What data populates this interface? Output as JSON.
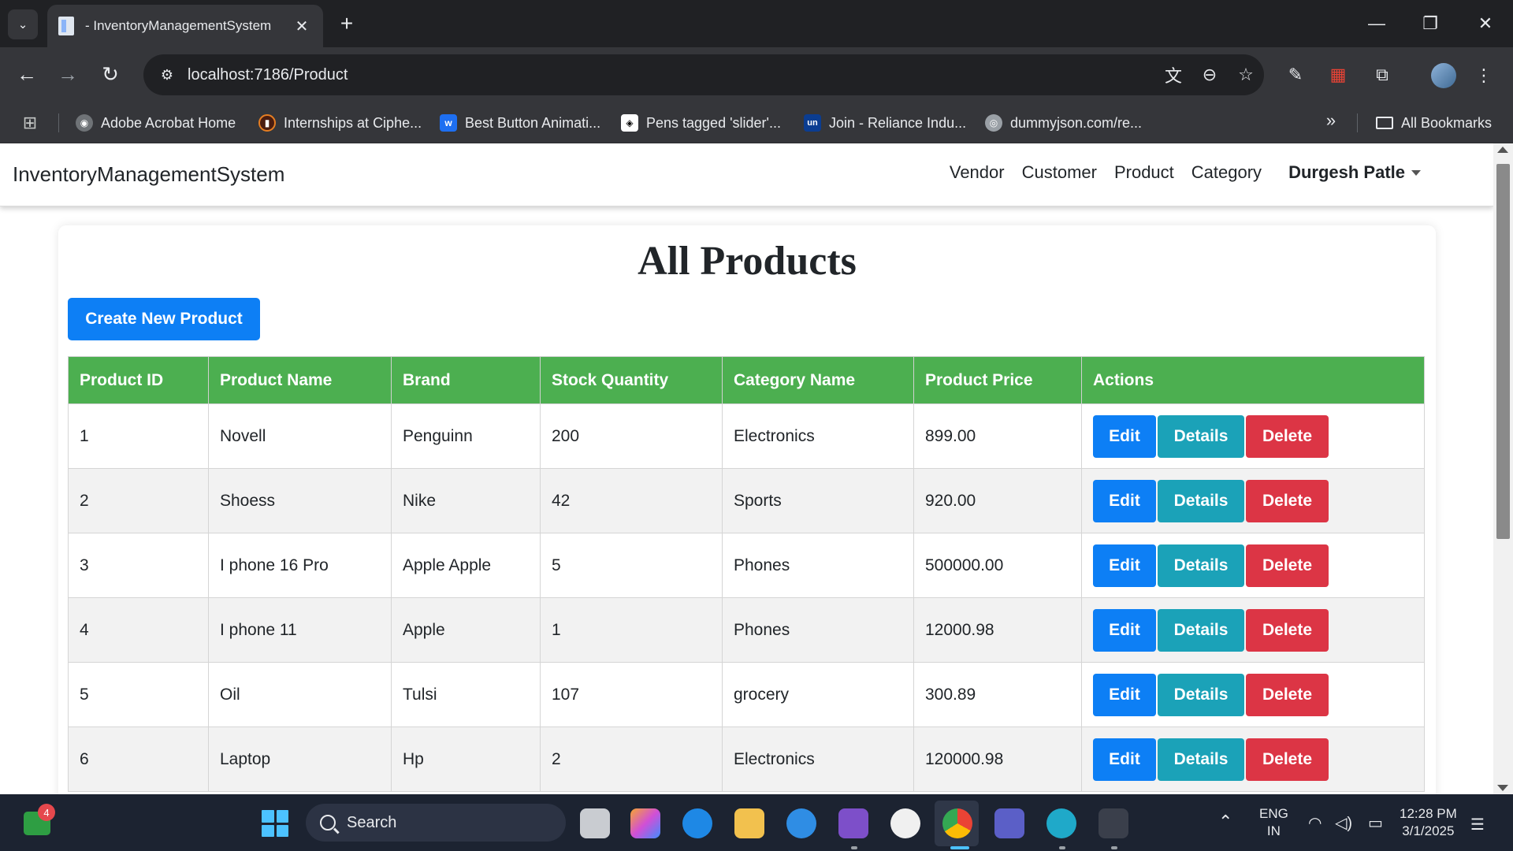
{
  "browser": {
    "tab_title": "- InventoryManagementSystem",
    "tab_close": "✕",
    "new_tab": "+",
    "url": "localhost:7186/Product",
    "bookmarks": [
      {
        "label": "Adobe Acrobat Home",
        "icon_color": "#6f7377"
      },
      {
        "label": "Internships at Ciphe...",
        "icon_color": "#c0392b"
      },
      {
        "label": "Best Button Animati...",
        "icon_color": "#1e6ff1"
      },
      {
        "label": "Pens tagged 'slider'...",
        "icon_color": "#ffffff"
      },
      {
        "label": "Join - Reliance Indu...",
        "icon_color": "#0b3d91"
      },
      {
        "label": "dummyjson.com/re...",
        "icon_color": "#9aa0a6"
      }
    ],
    "bookmarks_more": "»",
    "all_bookmarks": "All Bookmarks",
    "icons": [
      "back-arrow-icon",
      "forward-arrow-icon",
      "reload-icon",
      "translate-icon",
      "zoom-icon",
      "star-icon",
      "pen-icon",
      "extension-icon",
      "puzzle-icon",
      "profile-avatar",
      "kebab-menu-icon"
    ]
  },
  "site": {
    "brand": "InventoryManagementSystem",
    "nav_links": [
      "Vendor",
      "Customer",
      "Product",
      "Category"
    ],
    "user_name": "Durgesh Patle"
  },
  "page": {
    "title": "All Products",
    "create_button": "Create New Product"
  },
  "table": {
    "headers": [
      "Product ID",
      "Product Name",
      "Brand",
      "Stock Quantity",
      "Category Name",
      "Product Price",
      "Actions"
    ],
    "rows": [
      [
        "1",
        "Novell",
        "Penguinn",
        "200",
        "Electronics",
        "899.00"
      ],
      [
        "2",
        "Shoess",
        "Nike",
        "42",
        "Sports",
        "920.00"
      ],
      [
        "3",
        "I phone 16 Pro",
        "Apple Apple",
        "5",
        "Phones",
        "500000.00"
      ],
      [
        "4",
        "I phone 11",
        "Apple",
        "1",
        "Phones",
        "12000.98"
      ],
      [
        "5",
        "Oil",
        "Tulsi",
        "107",
        "grocery",
        "300.89"
      ],
      [
        "6",
        "Laptop",
        "Hp",
        "2",
        "Electronics",
        "120000.98"
      ]
    ],
    "action_labels": {
      "edit": "Edit",
      "details": "Details",
      "delete": "Delete"
    },
    "header_color": "#4caf50",
    "button_colors": {
      "edit": "#0d7ff5",
      "details": "#1ba2b8",
      "delete": "#dc3545"
    }
  },
  "taskbar": {
    "widgets_badge": "4",
    "search_label": "Search",
    "lang_line1": "ENG",
    "lang_line2": "IN",
    "time": "12:28 PM",
    "date": "3/1/2025"
  }
}
